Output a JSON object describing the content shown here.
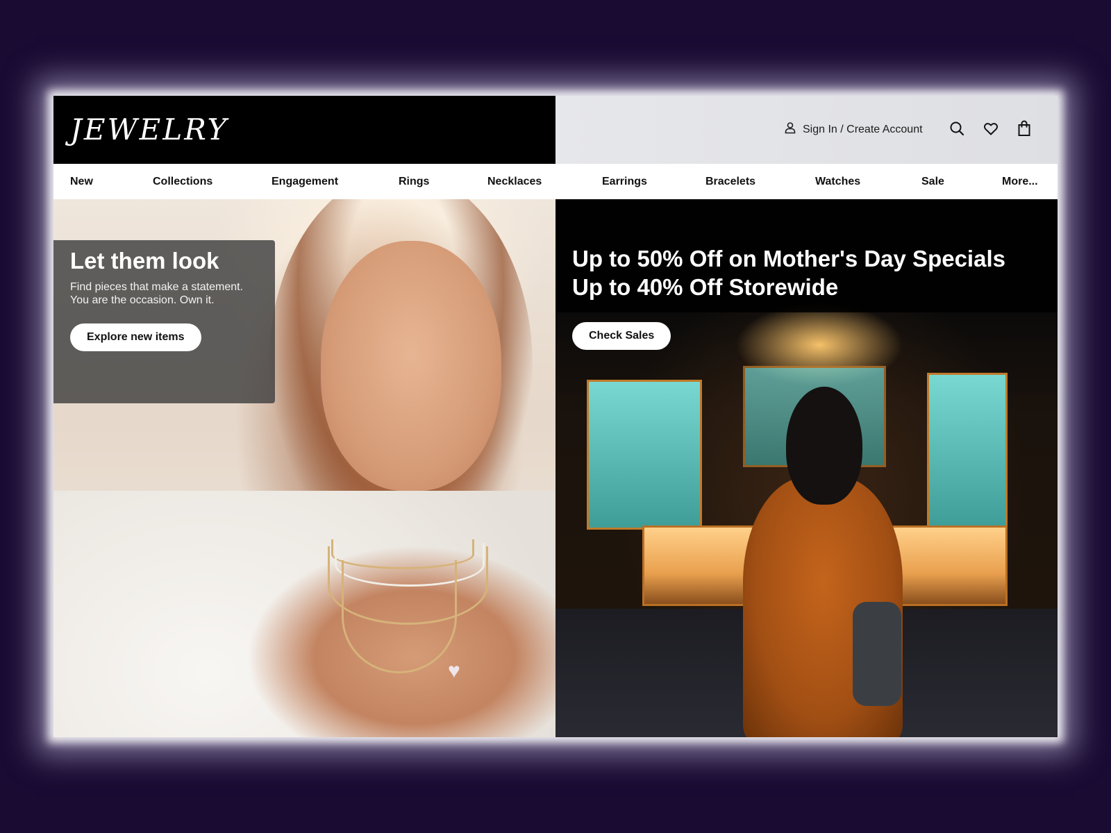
{
  "brand": {
    "logo_text": "JEWELRY"
  },
  "header": {
    "account_label": "Sign In / Create Account",
    "icons": [
      "user-icon",
      "search-icon",
      "heart-icon",
      "shopping-bag-icon"
    ]
  },
  "nav": {
    "items": [
      {
        "label": "New"
      },
      {
        "label": "Collections"
      },
      {
        "label": "Engagement"
      },
      {
        "label": "Rings"
      },
      {
        "label": "Necklaces"
      },
      {
        "label": "Earrings"
      },
      {
        "label": "Bracelets"
      },
      {
        "label": "Watches"
      },
      {
        "label": "Sale"
      },
      {
        "label": "More..."
      }
    ]
  },
  "hero_left": {
    "title": "Let them look",
    "description_line1": "Find pieces that make a statement.",
    "description_line2": "You are the occasion. Own it.",
    "button_label": "Explore new items"
  },
  "hero_right": {
    "headline_line1": "Up to 50% Off on Mother's Day Specials",
    "headline_line2": "Up to 40% Off Storewide",
    "button_label": "Check Sales"
  },
  "colors": {
    "page_background": "#190b32",
    "header_left": "#000000",
    "header_right": "#e3e4e8",
    "button_bg": "#ffffff",
    "text_dark": "#111111"
  }
}
